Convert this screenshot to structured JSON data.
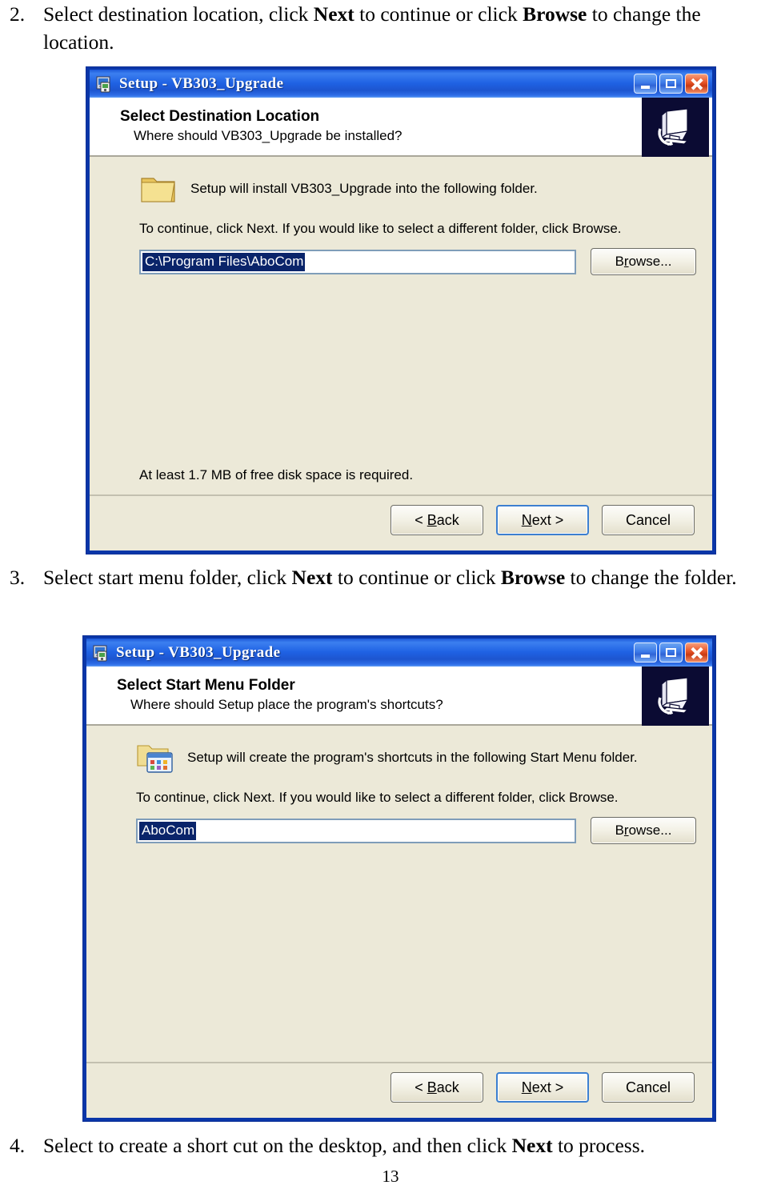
{
  "document": {
    "steps": [
      {
        "number": "2.",
        "segments": [
          {
            "text": "Select destination location, click ",
            "bold": false
          },
          {
            "text": "Next",
            "bold": true
          },
          {
            "text": " to continue or click ",
            "bold": false
          },
          {
            "text": "Browse",
            "bold": true
          },
          {
            "text": " to change the location.",
            "bold": false
          }
        ]
      },
      {
        "number": "3.",
        "segments": [
          {
            "text": "Select start menu folder, click ",
            "bold": false
          },
          {
            "text": "Next",
            "bold": true
          },
          {
            "text": " to continue or click ",
            "bold": false
          },
          {
            "text": "Browse",
            "bold": true
          },
          {
            "text": " to change the folder.",
            "bold": false
          }
        ]
      },
      {
        "number": "4.",
        "segments": [
          {
            "text": "Select to create a short cut on the desktop, and then click ",
            "bold": false
          },
          {
            "text": "Next",
            "bold": true
          },
          {
            "text": " to process.",
            "bold": false
          }
        ]
      }
    ],
    "page_number": "13"
  },
  "dialog1": {
    "window_title": "Setup - VB303_Upgrade",
    "window_icon": "setup-installer-icon",
    "controls": {
      "minimize": "minimize-button",
      "maximize": "maximize-button",
      "close": "close-button"
    },
    "header": {
      "title": "Select Destination Location",
      "subtitle": "Where should VB303_Upgrade be installed?",
      "icon": "computer-install-icon"
    },
    "body": {
      "icon": "folder-icon",
      "instruction": "Setup will install VB303_Upgrade into the following folder.",
      "hint": "To continue, click Next. If you would like to select a different folder, click Browse.",
      "path_value": "C:\\Program Files\\AboCom",
      "path_selected": true,
      "browse_label": "Browse...",
      "disk_space_note": "At least 1.7 MB of free disk space is required."
    },
    "footer": {
      "back_label": "< Back",
      "back_accel": "B",
      "next_label": "Next >",
      "next_accel": "N",
      "cancel_label": "Cancel",
      "default_button": "next"
    }
  },
  "dialog2": {
    "window_title": "Setup - VB303_Upgrade",
    "window_icon": "setup-installer-icon",
    "controls": {
      "minimize": "minimize-button",
      "maximize": "maximize-button",
      "close": "close-button"
    },
    "header": {
      "title": "Select Start Menu Folder",
      "subtitle": "Where should Setup place the program's shortcuts?",
      "icon": "computer-install-icon"
    },
    "body": {
      "icon": "start-menu-folder-icon",
      "instruction": "Setup will create the program's shortcuts in the following Start Menu folder.",
      "hint": "To continue, click Next. If you would like to select a different folder, click Browse.",
      "path_value": "AboCom",
      "path_selected": true,
      "browse_label": "Browse...",
      "disk_space_note": ""
    },
    "footer": {
      "back_label": "< Back",
      "back_accel": "B",
      "next_label": "Next >",
      "next_accel": "N",
      "cancel_label": "Cancel",
      "default_button": "next"
    }
  },
  "colors": {
    "titlebar_blue": "#1f62e4",
    "window_border": "#0a36a8",
    "dialog_face": "#ece9d8",
    "selection_blue": "#0a246a",
    "header_icon_bg": "#0b0b33",
    "close_red": "#e8572a"
  }
}
